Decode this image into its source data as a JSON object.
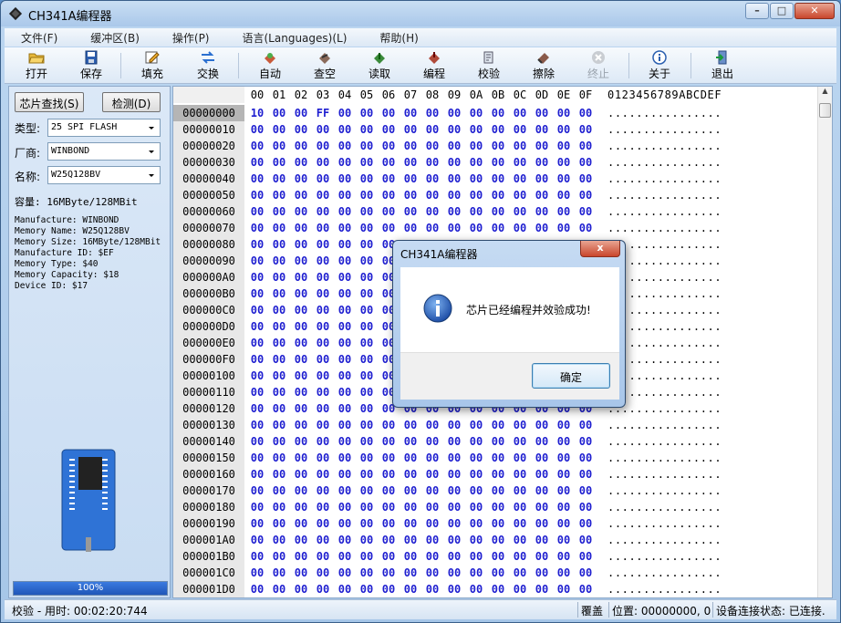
{
  "window": {
    "title": "CH341A编程器"
  },
  "menu": [
    "文件(F)",
    "缓冲区(B)",
    "操作(P)",
    "语言(Languages)(L)",
    "帮助(H)"
  ],
  "toolbar": [
    {
      "name": "open",
      "label": "打开",
      "icon": "folder-open-icon",
      "enabled": true
    },
    {
      "name": "save",
      "label": "保存",
      "icon": "floppy-disk-icon",
      "enabled": true
    },
    {
      "name": "fill",
      "label": "填充",
      "icon": "pencil-edit-icon",
      "enabled": true
    },
    {
      "name": "swap",
      "label": "交换",
      "icon": "swap-arrows-icon",
      "enabled": true
    },
    {
      "name": "auto",
      "label": "自动",
      "icon": "auto-chip-icon",
      "enabled": true
    },
    {
      "name": "blank-check",
      "label": "查空",
      "icon": "blank-check-icon",
      "enabled": true
    },
    {
      "name": "read",
      "label": "读取",
      "icon": "read-chip-icon",
      "enabled": true
    },
    {
      "name": "program",
      "label": "编程",
      "icon": "program-chip-icon",
      "enabled": true
    },
    {
      "name": "verify",
      "label": "校验",
      "icon": "verify-icon",
      "enabled": true
    },
    {
      "name": "erase",
      "label": "擦除",
      "icon": "eraser-icon",
      "enabled": true
    },
    {
      "name": "stop",
      "label": "终止",
      "icon": "stop-icon",
      "enabled": false
    },
    {
      "name": "about",
      "label": "关于",
      "icon": "info-icon",
      "enabled": true
    },
    {
      "name": "exit",
      "label": "退出",
      "icon": "exit-door-icon",
      "enabled": true
    }
  ],
  "left": {
    "find_chip": "芯片查找(S)",
    "detect": "检测(D)",
    "type_label": "类型:",
    "type_value": "25 SPI FLASH",
    "vendor_label": "厂商:",
    "vendor_value": "WINBOND",
    "name_label": "名称:",
    "name_value": "W25Q128BV",
    "capacity": "容量: 16MByte/128MBit",
    "info_lines": [
      "Manufacture: WINBOND",
      "Memory Name: W25Q128BV",
      "Memory Size: 16MByte/128MBit",
      "Manufacture ID: $EF",
      "Memory Type: $40",
      "Memory Capacity: $18",
      "Device ID: $17"
    ],
    "progress_text": "100%",
    "progress_value": 1.0
  },
  "hex": {
    "columns": [
      "00",
      "01",
      "02",
      "03",
      "04",
      "05",
      "06",
      "07",
      "08",
      "09",
      "0A",
      "0B",
      "0C",
      "0D",
      "0E",
      "0F"
    ],
    "ascii_header": "0123456789ABCDEF",
    "addresses": [
      "00000000",
      "00000010",
      "00000020",
      "00000030",
      "00000040",
      "00000050",
      "00000060",
      "00000070",
      "00000080",
      "00000090",
      "000000A0",
      "000000B0",
      "000000C0",
      "000000D0",
      "000000E0",
      "000000F0",
      "00000100",
      "00000110",
      "00000120",
      "00000130",
      "00000140",
      "00000150",
      "00000160",
      "00000170",
      "00000180",
      "00000190",
      "000001A0",
      "000001B0",
      "000001C0",
      "000001D0"
    ],
    "first_row": [
      "10",
      "00",
      "00",
      "FF",
      "00",
      "00",
      "00",
      "00",
      "00",
      "00",
      "00",
      "00",
      "00",
      "00",
      "00",
      "00"
    ],
    "fill_byte": "00",
    "ascii_row": "................"
  },
  "status": {
    "left": "校验 - 用时: 00:02:20:744",
    "mode": "覆盖",
    "position": "位置: 00000000, 0",
    "connection": "设备连接状态: 已连接."
  },
  "dialog": {
    "title": "CH341A编程器",
    "message": "芯片已经编程并效验成功!",
    "ok": "确定",
    "close": "x"
  }
}
